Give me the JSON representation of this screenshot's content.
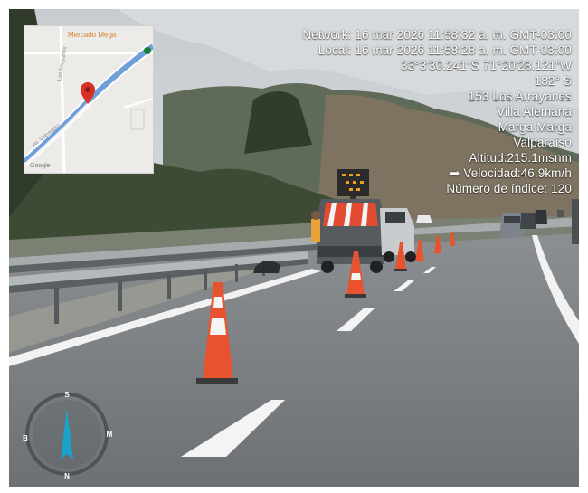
{
  "overlay": {
    "network_time": "Network: 16 mar 2026 11:58:32 a. m. GMT-03:00",
    "local_time": "Local: 16 mar 2026 11:58:28 a. m. GMT-03:00",
    "coordinates": "33°3'30.241\"S 71°20'28.121\"W",
    "heading": "182° S",
    "street": "153 Los Arrayanes",
    "city": "Villa Alemana",
    "province": "Marga Marga",
    "region": "Valparaíso",
    "altitude": "Altitud:215.1msnm",
    "speed": "Velocidad:46.9km/h",
    "index": "Número de índice: 120"
  },
  "map": {
    "place_label": "Mercado Mega",
    "road_label_1": "Los Arrayanes",
    "road_label_2": "Av. Valparaíso",
    "brand": "Google",
    "marker_icon": "map-pin-icon",
    "accent_color": "#d93025",
    "road_color": "#6f9fd8"
  },
  "compass": {
    "north": "S",
    "south": "N",
    "east": "M",
    "west": "B",
    "needle_color": "#1aa3c9"
  }
}
